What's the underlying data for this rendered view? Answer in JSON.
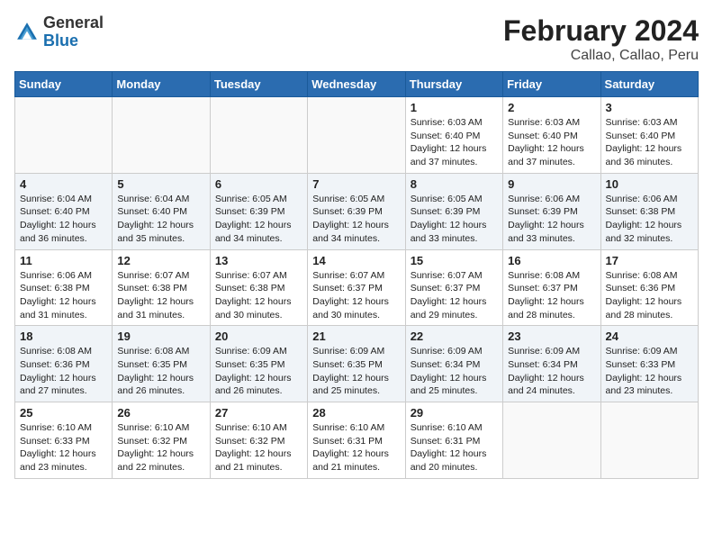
{
  "header": {
    "logo_general": "General",
    "logo_blue": "Blue",
    "title": "February 2024",
    "subtitle": "Callao, Callao, Peru"
  },
  "weekdays": [
    "Sunday",
    "Monday",
    "Tuesday",
    "Wednesday",
    "Thursday",
    "Friday",
    "Saturday"
  ],
  "weeks": [
    [
      {
        "num": "",
        "info": ""
      },
      {
        "num": "",
        "info": ""
      },
      {
        "num": "",
        "info": ""
      },
      {
        "num": "",
        "info": ""
      },
      {
        "num": "1",
        "info": "Sunrise: 6:03 AM\nSunset: 6:40 PM\nDaylight: 12 hours\nand 37 minutes."
      },
      {
        "num": "2",
        "info": "Sunrise: 6:03 AM\nSunset: 6:40 PM\nDaylight: 12 hours\nand 37 minutes."
      },
      {
        "num": "3",
        "info": "Sunrise: 6:03 AM\nSunset: 6:40 PM\nDaylight: 12 hours\nand 36 minutes."
      }
    ],
    [
      {
        "num": "4",
        "info": "Sunrise: 6:04 AM\nSunset: 6:40 PM\nDaylight: 12 hours\nand 36 minutes."
      },
      {
        "num": "5",
        "info": "Sunrise: 6:04 AM\nSunset: 6:40 PM\nDaylight: 12 hours\nand 35 minutes."
      },
      {
        "num": "6",
        "info": "Sunrise: 6:05 AM\nSunset: 6:39 PM\nDaylight: 12 hours\nand 34 minutes."
      },
      {
        "num": "7",
        "info": "Sunrise: 6:05 AM\nSunset: 6:39 PM\nDaylight: 12 hours\nand 34 minutes."
      },
      {
        "num": "8",
        "info": "Sunrise: 6:05 AM\nSunset: 6:39 PM\nDaylight: 12 hours\nand 33 minutes."
      },
      {
        "num": "9",
        "info": "Sunrise: 6:06 AM\nSunset: 6:39 PM\nDaylight: 12 hours\nand 33 minutes."
      },
      {
        "num": "10",
        "info": "Sunrise: 6:06 AM\nSunset: 6:38 PM\nDaylight: 12 hours\nand 32 minutes."
      }
    ],
    [
      {
        "num": "11",
        "info": "Sunrise: 6:06 AM\nSunset: 6:38 PM\nDaylight: 12 hours\nand 31 minutes."
      },
      {
        "num": "12",
        "info": "Sunrise: 6:07 AM\nSunset: 6:38 PM\nDaylight: 12 hours\nand 31 minutes."
      },
      {
        "num": "13",
        "info": "Sunrise: 6:07 AM\nSunset: 6:38 PM\nDaylight: 12 hours\nand 30 minutes."
      },
      {
        "num": "14",
        "info": "Sunrise: 6:07 AM\nSunset: 6:37 PM\nDaylight: 12 hours\nand 30 minutes."
      },
      {
        "num": "15",
        "info": "Sunrise: 6:07 AM\nSunset: 6:37 PM\nDaylight: 12 hours\nand 29 minutes."
      },
      {
        "num": "16",
        "info": "Sunrise: 6:08 AM\nSunset: 6:37 PM\nDaylight: 12 hours\nand 28 minutes."
      },
      {
        "num": "17",
        "info": "Sunrise: 6:08 AM\nSunset: 6:36 PM\nDaylight: 12 hours\nand 28 minutes."
      }
    ],
    [
      {
        "num": "18",
        "info": "Sunrise: 6:08 AM\nSunset: 6:36 PM\nDaylight: 12 hours\nand 27 minutes."
      },
      {
        "num": "19",
        "info": "Sunrise: 6:08 AM\nSunset: 6:35 PM\nDaylight: 12 hours\nand 26 minutes."
      },
      {
        "num": "20",
        "info": "Sunrise: 6:09 AM\nSunset: 6:35 PM\nDaylight: 12 hours\nand 26 minutes."
      },
      {
        "num": "21",
        "info": "Sunrise: 6:09 AM\nSunset: 6:35 PM\nDaylight: 12 hours\nand 25 minutes."
      },
      {
        "num": "22",
        "info": "Sunrise: 6:09 AM\nSunset: 6:34 PM\nDaylight: 12 hours\nand 25 minutes."
      },
      {
        "num": "23",
        "info": "Sunrise: 6:09 AM\nSunset: 6:34 PM\nDaylight: 12 hours\nand 24 minutes."
      },
      {
        "num": "24",
        "info": "Sunrise: 6:09 AM\nSunset: 6:33 PM\nDaylight: 12 hours\nand 23 minutes."
      }
    ],
    [
      {
        "num": "25",
        "info": "Sunrise: 6:10 AM\nSunset: 6:33 PM\nDaylight: 12 hours\nand 23 minutes."
      },
      {
        "num": "26",
        "info": "Sunrise: 6:10 AM\nSunset: 6:32 PM\nDaylight: 12 hours\nand 22 minutes."
      },
      {
        "num": "27",
        "info": "Sunrise: 6:10 AM\nSunset: 6:32 PM\nDaylight: 12 hours\nand 21 minutes."
      },
      {
        "num": "28",
        "info": "Sunrise: 6:10 AM\nSunset: 6:31 PM\nDaylight: 12 hours\nand 21 minutes."
      },
      {
        "num": "29",
        "info": "Sunrise: 6:10 AM\nSunset: 6:31 PM\nDaylight: 12 hours\nand 20 minutes."
      },
      {
        "num": "",
        "info": ""
      },
      {
        "num": "",
        "info": ""
      }
    ]
  ]
}
